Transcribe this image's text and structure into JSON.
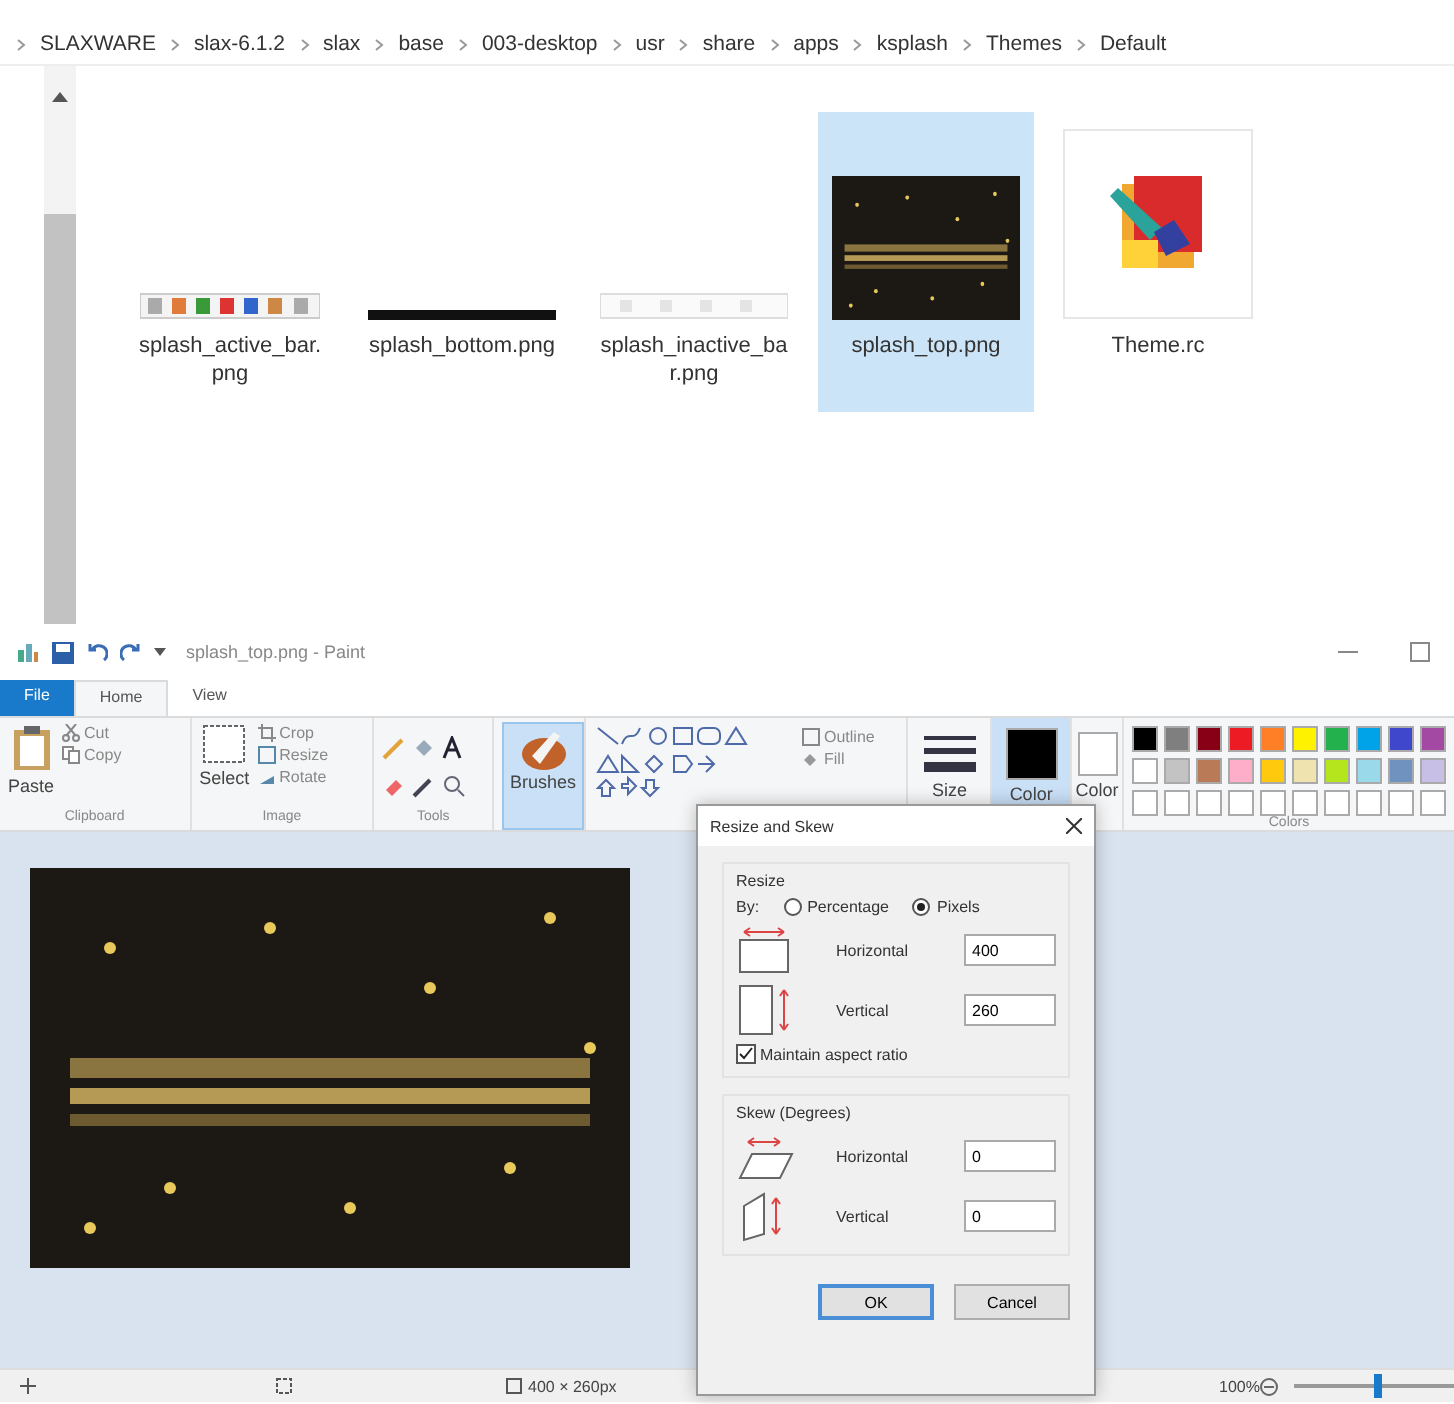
{
  "breadcrumb": [
    "SLAXWARE",
    "slax-6.1.2",
    "slax",
    "base",
    "003-desktop",
    "usr",
    "share",
    "apps",
    "ksplash",
    "Themes",
    "Default"
  ],
  "files": [
    {
      "name": "splash_active_bar.png",
      "kind": "strip",
      "selected": false
    },
    {
      "name": "splash_bottom.png",
      "kind": "line",
      "selected": false
    },
    {
      "name": "splash_inactive_bar.png",
      "kind": "faded",
      "selected": false
    },
    {
      "name": "splash_top.png",
      "kind": "picture",
      "selected": true
    },
    {
      "name": "Theme.rc",
      "kind": "document",
      "selected": false
    }
  ],
  "paint": {
    "title": "splash_top.png - Paint",
    "tabs": [
      {
        "label": "File",
        "kind": "file",
        "selected": false
      },
      {
        "label": "Home",
        "kind": "tab",
        "selected": true
      },
      {
        "label": "View",
        "kind": "tab",
        "selected": false
      }
    ],
    "ribbon": {
      "paste": "Paste",
      "cut": "Cut",
      "copy": "Copy",
      "clipboard_label": "Clipboard",
      "select": "Select",
      "crop": "Crop",
      "resize": "Resize",
      "rotate": "Rotate",
      "image_label": "Image",
      "tools_label": "Tools",
      "brushes": "Brushes",
      "brushes_selected": true,
      "outline": "Outline",
      "fill": "Fill",
      "size": "Size",
      "color1": "Color",
      "color2": "Color",
      "colors_label": "Colors",
      "palette": [
        {
          "color": "#000000"
        },
        {
          "color": "#7f7f7f"
        },
        {
          "color": "#880015"
        },
        {
          "color": "#ed1c24"
        },
        {
          "color": "#ff7f27"
        },
        {
          "color": "#fff200"
        },
        {
          "color": "#22b14c"
        },
        {
          "color": "#00a2e8"
        },
        {
          "color": "#3f48cc"
        },
        {
          "color": "#a349a4"
        },
        {
          "color": "#ffffff"
        },
        {
          "color": "#c3c3c3"
        },
        {
          "color": "#b97a57"
        },
        {
          "color": "#ffaec9"
        },
        {
          "color": "#ffc90e"
        },
        {
          "color": "#efe4b0"
        },
        {
          "color": "#b5e61d"
        },
        {
          "color": "#99d9ea"
        },
        {
          "color": "#7092be"
        },
        {
          "color": "#c8bfe7"
        }
      ]
    },
    "status": {
      "size": "400 × 260px",
      "zoom": "100%",
      "level": 0.5
    }
  },
  "dialog": {
    "title": "Resize and Skew",
    "resize_label": "Resize",
    "by": "By:",
    "options": [
      {
        "label": "Percentage",
        "selected": false
      },
      {
        "label": "Pixels",
        "selected": true
      }
    ],
    "horizontal": {
      "label": "Horizontal",
      "value": "400"
    },
    "vertical": {
      "label": "Vertical",
      "value": "260"
    },
    "maintain": {
      "label": "Maintain aspect ratio",
      "checked": true
    },
    "skew_label": "Skew (Degrees)",
    "skew_horizontal": {
      "label": "Horizontal",
      "value": "0"
    },
    "skew_vertical": {
      "label": "Vertical",
      "value": "0"
    },
    "buttons": [
      "OK",
      "Cancel"
    ]
  }
}
